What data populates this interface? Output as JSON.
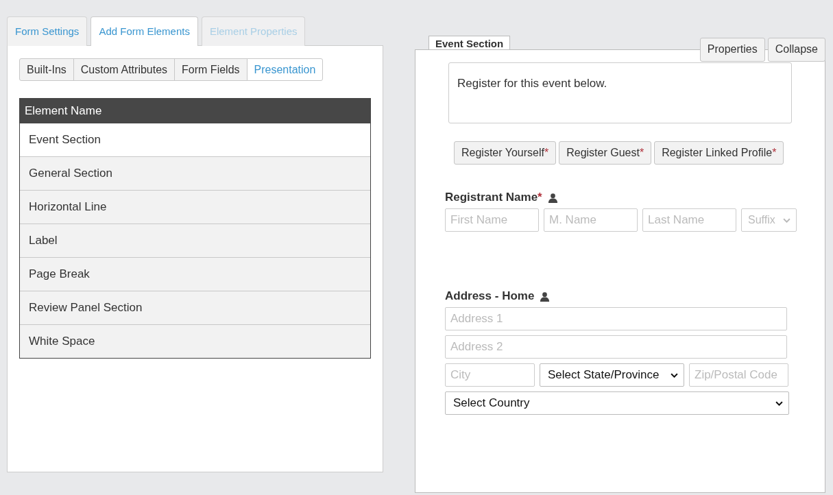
{
  "tabs": [
    {
      "label": "Form Settings",
      "selected": false,
      "disabled": false
    },
    {
      "label": "Add Form Elements",
      "selected": true,
      "disabled": false
    },
    {
      "label": "Element Properties",
      "selected": false,
      "disabled": true
    }
  ],
  "subtabs": [
    {
      "label": "Built-Ins",
      "selected": false
    },
    {
      "label": "Custom Attributes",
      "selected": false
    },
    {
      "label": "Form Fields",
      "selected": false
    },
    {
      "label": "Presentation",
      "selected": true
    }
  ],
  "table": {
    "columns": [
      "Element Name"
    ],
    "rows": [
      {
        "name": "Event Section",
        "selected": true
      },
      {
        "name": "General Section",
        "selected": false
      },
      {
        "name": "Horizontal Line",
        "selected": false
      },
      {
        "name": "Label",
        "selected": false
      },
      {
        "name": "Page Break",
        "selected": false
      },
      {
        "name": "Review Panel Section",
        "selected": false
      },
      {
        "name": "White Space",
        "selected": false
      }
    ]
  },
  "section": {
    "title": "Event Section",
    "buttons": [
      "Properties",
      "Collapse"
    ],
    "intro": "Register for this event below.",
    "register_buttons": [
      {
        "label": "Register Yourself",
        "required_mark": "*"
      },
      {
        "label": "Register Guest",
        "required_mark": "*"
      },
      {
        "label": "Register Linked Profile",
        "required_mark": "*"
      }
    ],
    "groups": [
      {
        "label": "Registrant Name",
        "required_mark": "*",
        "rows": [
          [
            {
              "kind": "text",
              "placeholder": "First Name"
            },
            {
              "kind": "text",
              "placeholder": "M. Name"
            },
            {
              "kind": "text",
              "placeholder": "Last Name"
            },
            {
              "kind": "select",
              "value": "Suffix",
              "disabled": true
            }
          ]
        ]
      },
      {
        "label": "Address - Home",
        "rows": [
          [
            {
              "kind": "text",
              "placeholder": "Address 1"
            }
          ],
          [
            {
              "kind": "text",
              "placeholder": "Address 2"
            }
          ],
          [
            {
              "kind": "text",
              "placeholder": "City"
            },
            {
              "kind": "select",
              "value": "Select State/Province",
              "disabled": false
            },
            {
              "kind": "text",
              "placeholder": "Zip/Postal Code"
            }
          ],
          [
            {
              "kind": "select",
              "value": "Select Country",
              "disabled": false
            }
          ]
        ]
      }
    ]
  }
}
